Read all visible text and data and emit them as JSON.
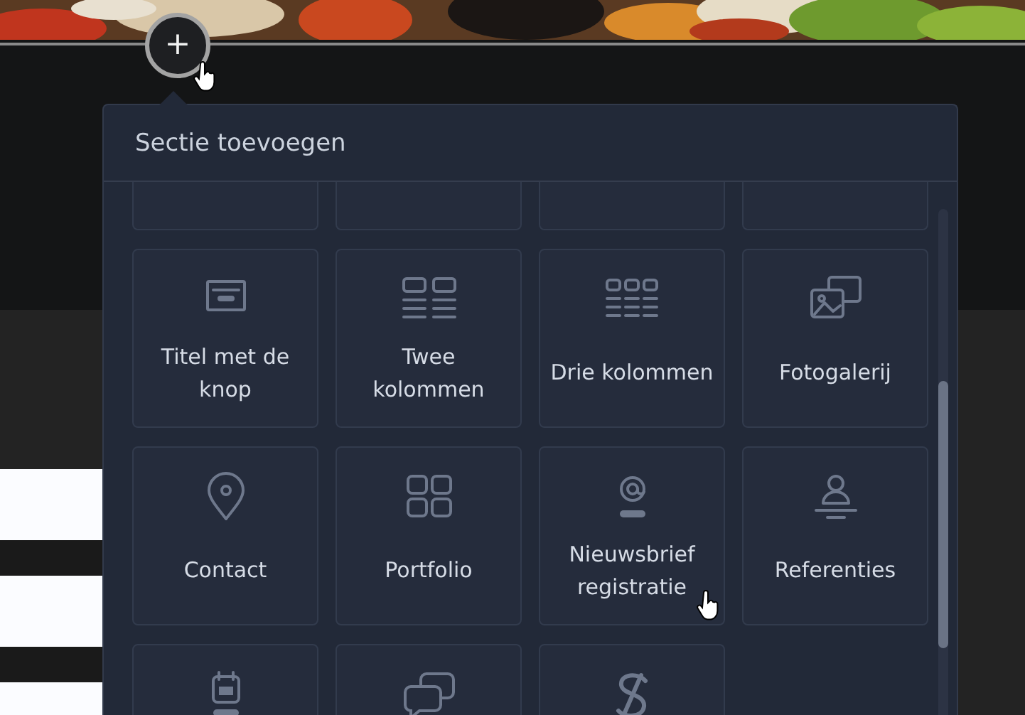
{
  "add_button": {
    "label": "+"
  },
  "panel": {
    "title": "Sectie toevoegen",
    "tiles": [
      {
        "kind": "blank"
      },
      {
        "kind": "blank"
      },
      {
        "kind": "blank"
      },
      {
        "kind": "blank"
      },
      {
        "kind": "title-button",
        "label": "Titel met de knop"
      },
      {
        "kind": "two-columns",
        "label": "Twee kolommen"
      },
      {
        "kind": "three-columns",
        "label": "Drie kolommen"
      },
      {
        "kind": "gallery",
        "label": "Fotogalerij"
      },
      {
        "kind": "pin",
        "label": "Contact"
      },
      {
        "kind": "grid",
        "label": "Portfolio"
      },
      {
        "kind": "at",
        "label": "Nieuwsbrief registratie"
      },
      {
        "kind": "person",
        "label": "Referenties"
      },
      {
        "kind": "calendar"
      },
      {
        "kind": "chat"
      },
      {
        "kind": "dollar"
      }
    ]
  }
}
